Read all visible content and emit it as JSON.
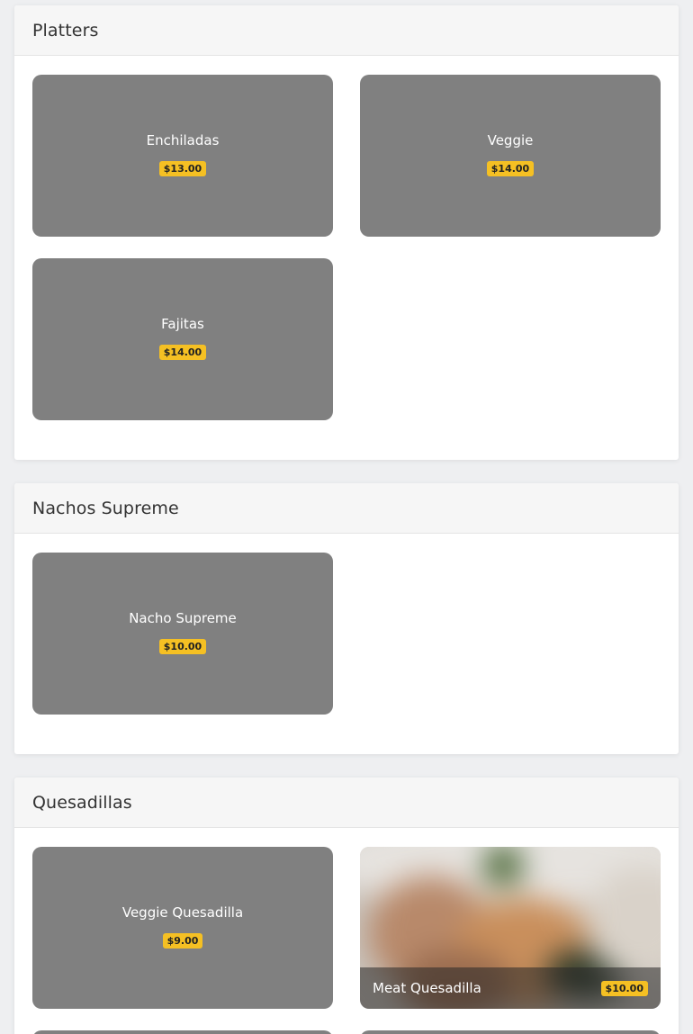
{
  "sections": [
    {
      "title": "Platters",
      "items": [
        {
          "name": "Enchiladas",
          "price": "$13.00"
        },
        {
          "name": "Veggie",
          "price": "$14.00"
        },
        {
          "name": "Fajitas",
          "price": "$14.00"
        }
      ]
    },
    {
      "title": "Nachos Supreme",
      "items": [
        {
          "name": "Nacho Supreme",
          "price": "$10.00"
        }
      ]
    },
    {
      "title": "Quesadillas",
      "items": [
        {
          "name": "Veggie Quesadilla",
          "price": "$9.00"
        },
        {
          "name": "Meat Quesadilla",
          "price": "$10.00",
          "has_photo": true
        }
      ]
    }
  ],
  "colors": {
    "card_placeholder": "#808080",
    "price_badge": "#f5c023",
    "section_header_bg": "#f6f6f6",
    "page_bg": "#eeeff1"
  }
}
